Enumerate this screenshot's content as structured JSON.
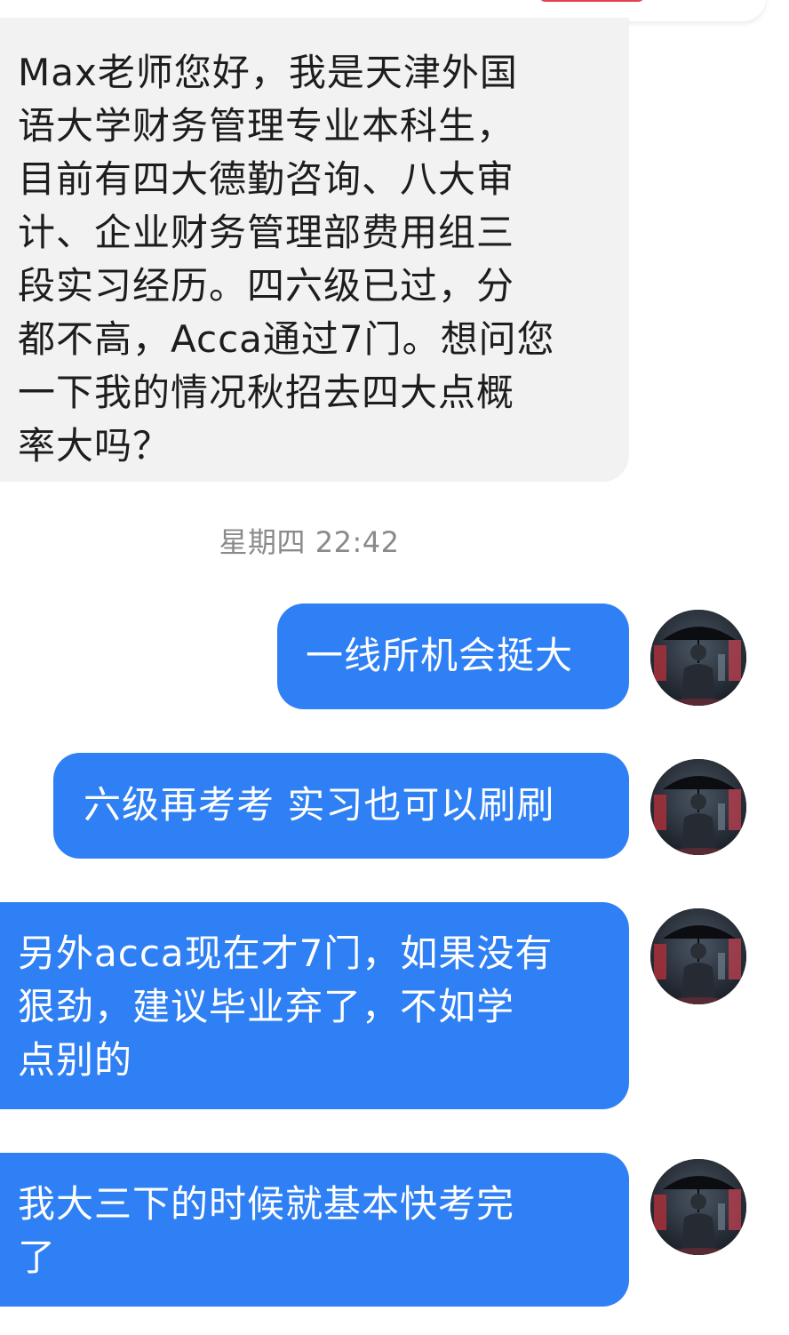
{
  "incoming_message": {
    "lines": [
      "Max老师您好，我是天津外国",
      "语大学财务管理专业本科生，",
      "目前有四大德勤咨询、八大审",
      "计、企业财务管理部费用组三",
      "段实习经历。四六级已过，分",
      "都不高，Acca通过7门。想问您",
      "一下我的情况秋招去四大点概",
      "率大吗？"
    ]
  },
  "timestamp": "星期四 22:42",
  "outgoing_messages": [
    {
      "text": "一线所机会挺大"
    },
    {
      "text": "六级再考考 实习也可以刷刷"
    },
    {
      "lines": [
        "另外acca现在才7门，如果没有",
        "狠劲，建议毕业弃了，不如学",
        "点别的"
      ]
    },
    {
      "lines": [
        "我大三下的时候就基本快考完",
        "了"
      ]
    }
  ],
  "colors": {
    "outgoing_bubble": "#2f80f4",
    "incoming_bubble": "#f2f2f2",
    "timestamp_text": "#8a8a8a"
  },
  "avatar_icon": "person-with-umbrella-avatar"
}
